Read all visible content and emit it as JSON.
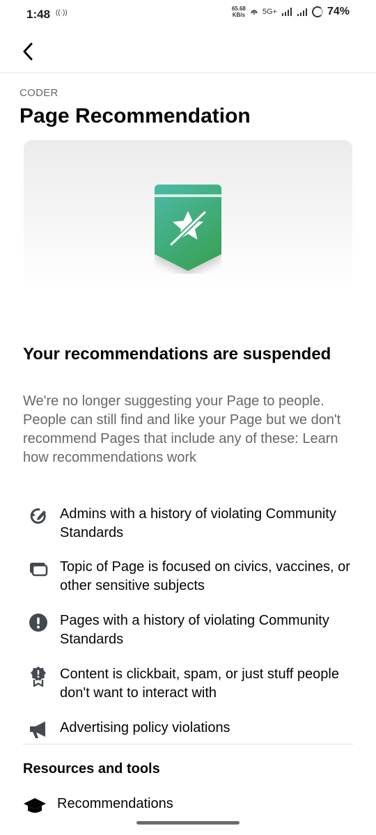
{
  "status_bar": {
    "time": "1:48",
    "hotspot": "((·))",
    "speed_value": "65.68",
    "speed_unit": "KB/s",
    "network": "5G+",
    "battery": "74%"
  },
  "header": {
    "back_icon": "chevron-left-icon"
  },
  "page": {
    "name": "CODER",
    "title": "Page Recommendation"
  },
  "hero": {
    "badge_icon": "star-slashed-badge-icon",
    "colors": {
      "badge_top": "#47b7a2",
      "badge_bottom": "#3ea75c",
      "accent": "#1877f2"
    }
  },
  "content": {
    "headline": "Your recommendations are suspended",
    "description": "We're no longer suggesting your Page to people. People can still find and like your Page but we don't recommend Pages that include any of these: Learn how recommendations work"
  },
  "reasons": [
    {
      "icon": "refresh-pencil-icon",
      "text": "Admins with a history of violating Community Standards"
    },
    {
      "icon": "cards-icon",
      "text": "Topic of Page is focused on civics, vaccines, or other sensitive subjects"
    },
    {
      "icon": "exclamation-circle-icon",
      "text": "Pages with a history of violating Community Standards"
    },
    {
      "icon": "badge-alert-icon",
      "text": "Content is clickbait, spam, or just stuff people don't want to interact with"
    },
    {
      "icon": "megaphone-icon",
      "text": "Advertising policy violations"
    }
  ],
  "resources": {
    "title": "Resources and tools",
    "items": [
      {
        "icon": "graduation-cap-icon",
        "label": "Recommendations"
      }
    ]
  }
}
